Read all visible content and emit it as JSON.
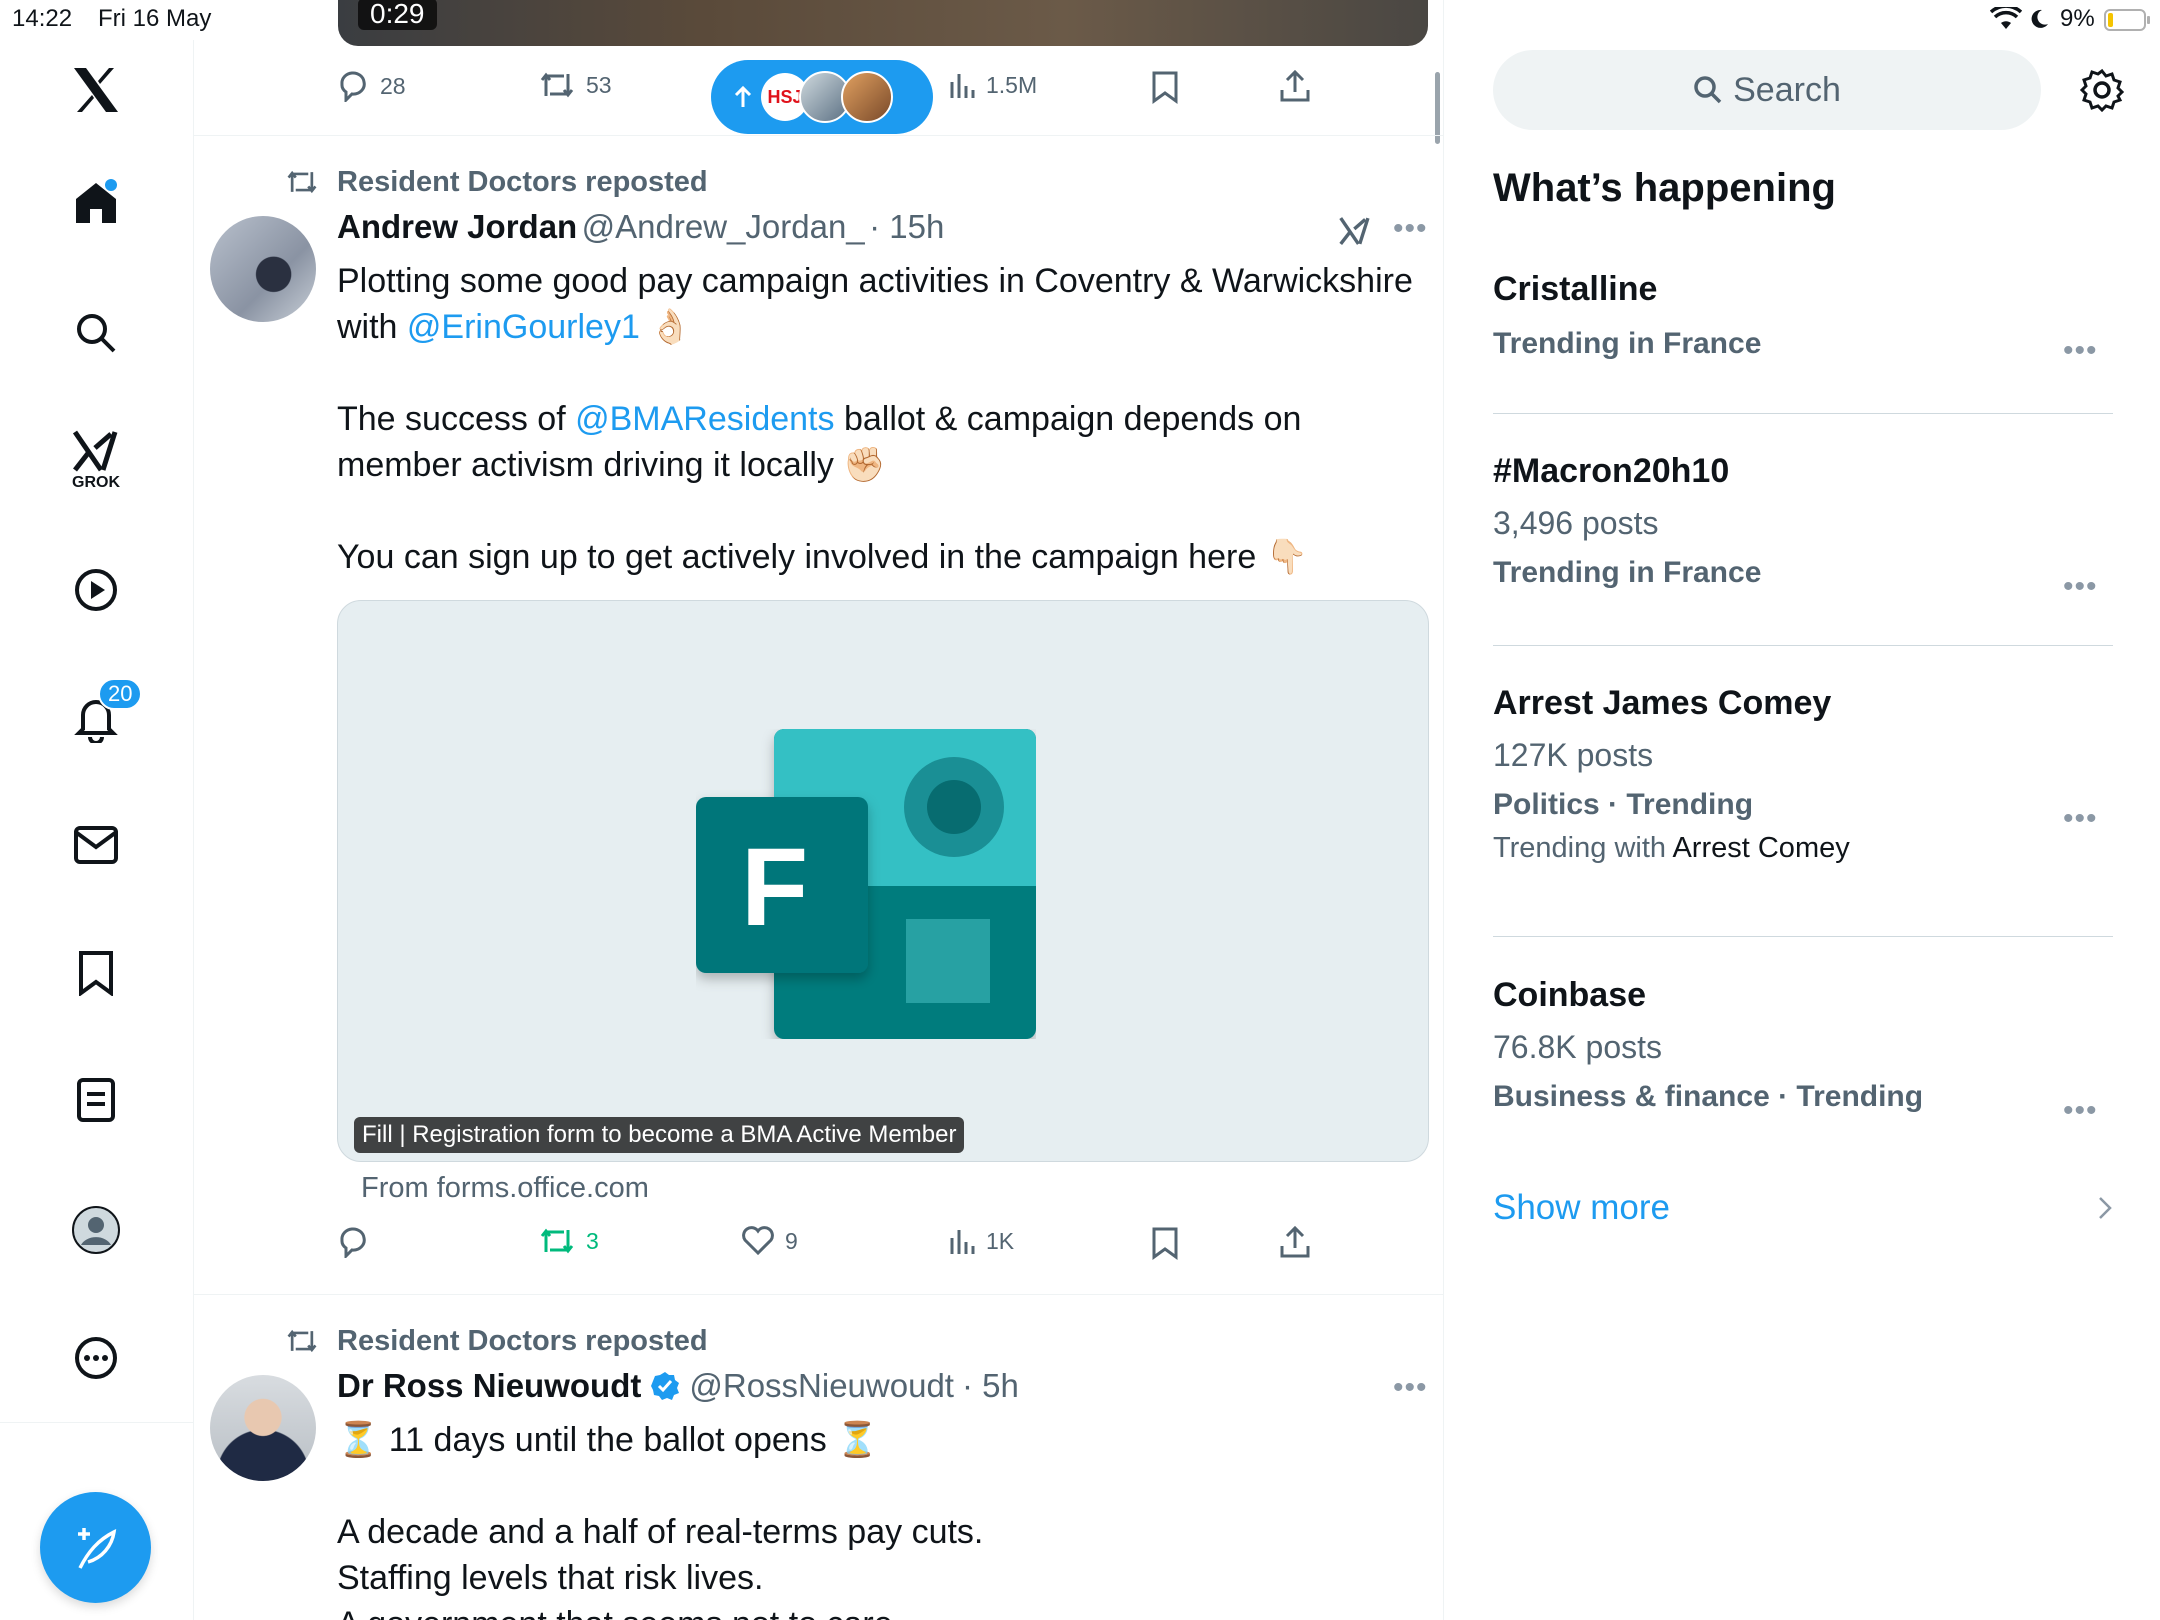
{
  "status_bar": {
    "time": "14:22",
    "date": "Fri 16 May",
    "battery": "9%"
  },
  "nav": {
    "grok_label": "GROK",
    "notifications_badge": "20"
  },
  "top_post": {
    "video_time": "0:29",
    "replies": "28",
    "reposts": "53",
    "views": "1.5M",
    "new_posts_pill_text": "HSJ"
  },
  "post1": {
    "repost_label": "Resident Doctors reposted",
    "name": "Andrew Jordan",
    "handle": "@Andrew_Jordan_",
    "time": "· 15h",
    "line1": "Plotting some good pay campaign activities in Coventry & Warwickshire",
    "line2_prefix": "with ",
    "mention1": "@ErinGourley1",
    "emoji1": "👌🏻",
    "line3_prefix": "The success of ",
    "mention2": "@BMAResidents",
    "line3_suffix": " ballot & campaign depends on",
    "line4": "member activism driving it locally",
    "emoji2": "✊🏻",
    "line5": "You can sign up to get actively involved in the campaign here",
    "emoji3": "👇🏻",
    "card_icon_letter": "F",
    "card_title": "Fill | Registration form to become a BMA Active Member",
    "card_source": "From forms.office.com",
    "replies": "",
    "reposts": "3",
    "likes": "9",
    "views": "1K"
  },
  "post2": {
    "repost_label": "Resident Doctors reposted",
    "name": "Dr Ross Nieuwoudt",
    "handle": "@RossNieuwoudt",
    "time": "· 5h",
    "line1_emoji": "⏳",
    "line1": "11 days until the ballot opens",
    "line2": "A decade and a half of real-terms pay cuts.",
    "line3": "Staffing levels that risk lives.",
    "line4": "A government that seems not to care"
  },
  "sidebar": {
    "search_placeholder": "Search",
    "heading": "What’s happening",
    "trends": [
      {
        "name": "Cristalline",
        "posts": "",
        "category": "Trending in France",
        "extra_prefix": "",
        "extra_term": ""
      },
      {
        "name": "#Macron20h10",
        "posts": "3,496 posts",
        "category": "Trending in France",
        "extra_prefix": "",
        "extra_term": ""
      },
      {
        "name": "Arrest James Comey",
        "posts": "127K posts",
        "category": "Politics · Trending",
        "extra_prefix": "Trending with ",
        "extra_term": "Arrest Comey"
      },
      {
        "name": "Coinbase",
        "posts": "76.8K posts",
        "category": "Business & finance · Trending",
        "extra_prefix": "",
        "extra_term": ""
      }
    ],
    "show_more": "Show more"
  },
  "colors": {
    "accent": "#1d9bf0",
    "repost_green": "#00ba7c",
    "secondary_text": "#536471"
  }
}
